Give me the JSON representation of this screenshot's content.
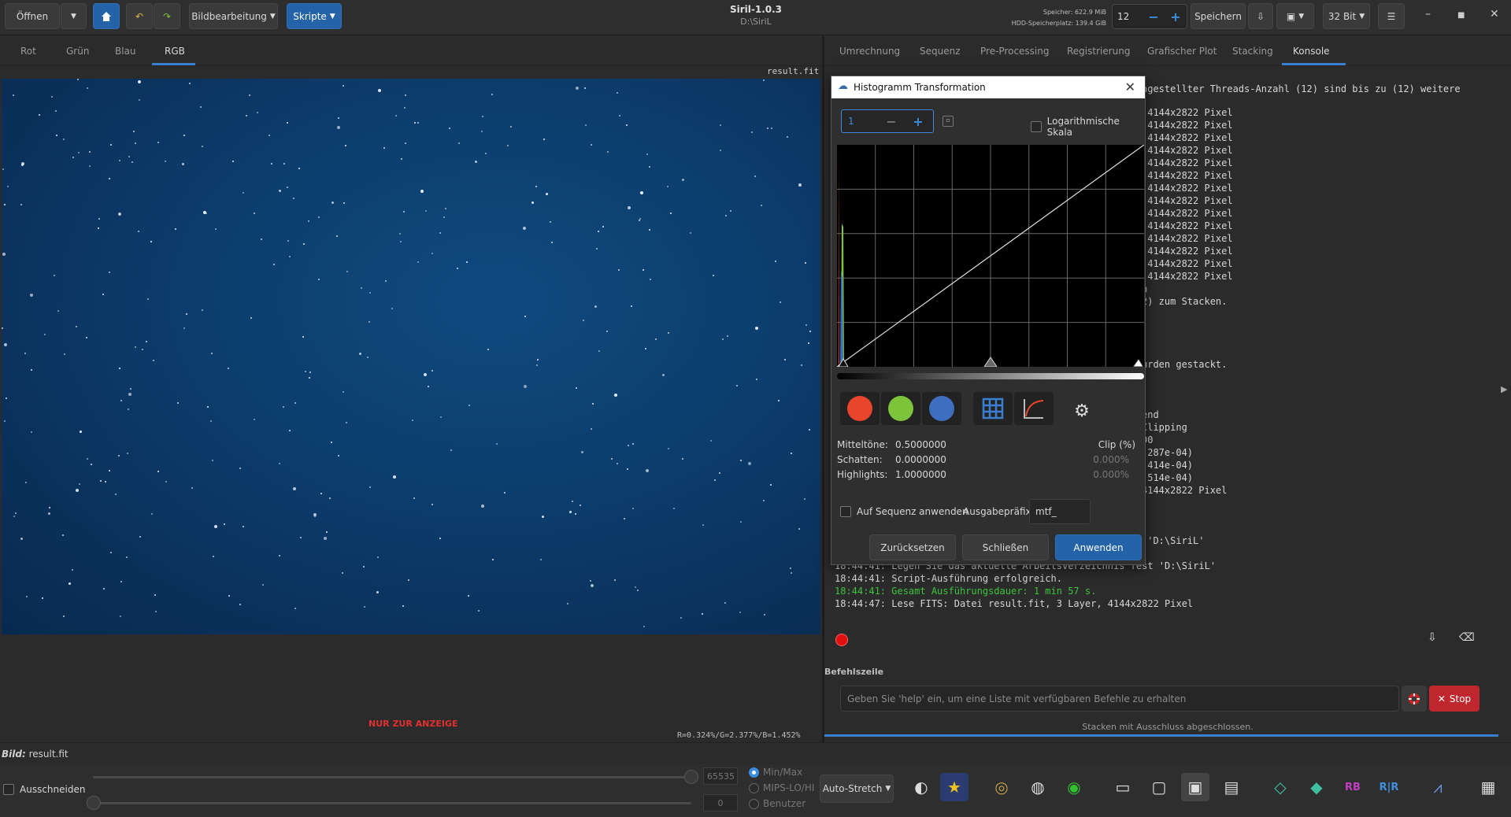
{
  "toolbar": {
    "open_label": "Öffnen",
    "image_processing_label": "Bildbearbeitung",
    "scripts_label": "Skripte",
    "save_label": "Speichern",
    "bit_depth": "32 Bit"
  },
  "window": {
    "title": "Siril-1.0.3",
    "path": "D:\\SiriL"
  },
  "memory": {
    "ram": "Speicher: 622.9 MiB",
    "disk": "HDD-Speicherplatz: 139.4 GiB"
  },
  "threads": {
    "value": "12"
  },
  "channels": {
    "tabs": [
      "Rot",
      "Grün",
      "Blau",
      "RGB"
    ],
    "active": "RGB"
  },
  "image": {
    "filename": "result.fit",
    "display_only": "NUR ZUR ANZEIGE",
    "rgb_values": "R=0.324%/G=2.377%/B=1.452%",
    "bild_prefix": "Bild:",
    "bild_name": "result.fit"
  },
  "bottom": {
    "crop_label": "Ausschneiden",
    "hi_value": "65535",
    "lo_value": "0",
    "radio": [
      "Min/Max",
      "MIPS-LO/HI",
      "Benutzer"
    ],
    "stretch_mode": "Auto-Stretch"
  },
  "right_tabs": {
    "tabs": [
      "Umrechnung",
      "Sequenz",
      "Pre-Processing",
      "Registrierung",
      "Grafischer Plot",
      "Stacking",
      "Konsole"
    ],
    "active": "Konsole"
  },
  "console": {
    "lines": [
      "ngestellter Threads-Anzahl (12) sind bis zu (12) weitere",
      " 4144x2822 Pixel",
      " 4144x2822 Pixel",
      " 4144x2822 Pixel",
      " 4144x2822 Pixel",
      " 4144x2822 Pixel",
      " 4144x2822 Pixel",
      " 4144x2822 Pixel",
      " 4144x2822 Pixel",
      " 4144x2822 Pixel",
      " 4144x2822 Pixel",
      " 4144x2822 Pixel",
      " 4144x2822 Pixel",
      " 4144x2822 Pixel",
      " 4144x2822 Pixel",
      "n",
      "2) zum Stacken.",
      "urden gestackt.",
      "end",
      "Clipping",
      "00",
      ".287e-04)",
      ".414e-04)",
      ".514e-04)",
      "4144x2822 Pixel",
      " 'D:\\SiriL'",
      "18:44:41: Legen Sie das aktuelle Arbeitsverzeichnis fest 'D:\\SiriL'",
      "18:44:41: Script-Ausführung erfolgreich.",
      "18:44:41: Gesamt Ausführungsdauer: 1 min 57 s.",
      "18:44:47: Lese FITS: Datei result.fit, 3 Layer, 4144x2822 Pixel"
    ]
  },
  "command": {
    "label": "Befehlszeile",
    "placeholder": "Geben Sie 'help' ein, um eine Liste mit verfügbaren Befehle zu erhalten",
    "stop_label": "Stop",
    "status": "Stacken mit Ausschluss abgeschlossen."
  },
  "dialog": {
    "title": "Histogramm Transformation",
    "zoom": "1",
    "log_scale_label": "Logarithmische Skala",
    "clip_header": "Clip (%)",
    "midtones_label": "Mitteltöne:",
    "midtones_value": "0.5000000",
    "shadows_label": "Schatten:",
    "shadows_value": "0.0000000",
    "shadows_clip": "0.000%",
    "highlights_label": "Highlights:",
    "highlights_value": "1.0000000",
    "highlights_clip": "0.000%",
    "apply_seq_label": "Auf Sequenz anwenden",
    "prefix_label": "Ausgabepräfix:",
    "prefix_value": "mtf_",
    "reset_label": "Zurücksetzen",
    "close_label": "Schließen",
    "apply_label": "Anwenden",
    "colors": {
      "red": "#e8452c",
      "green": "#7cc43a",
      "blue": "#3f6fc0"
    }
  }
}
